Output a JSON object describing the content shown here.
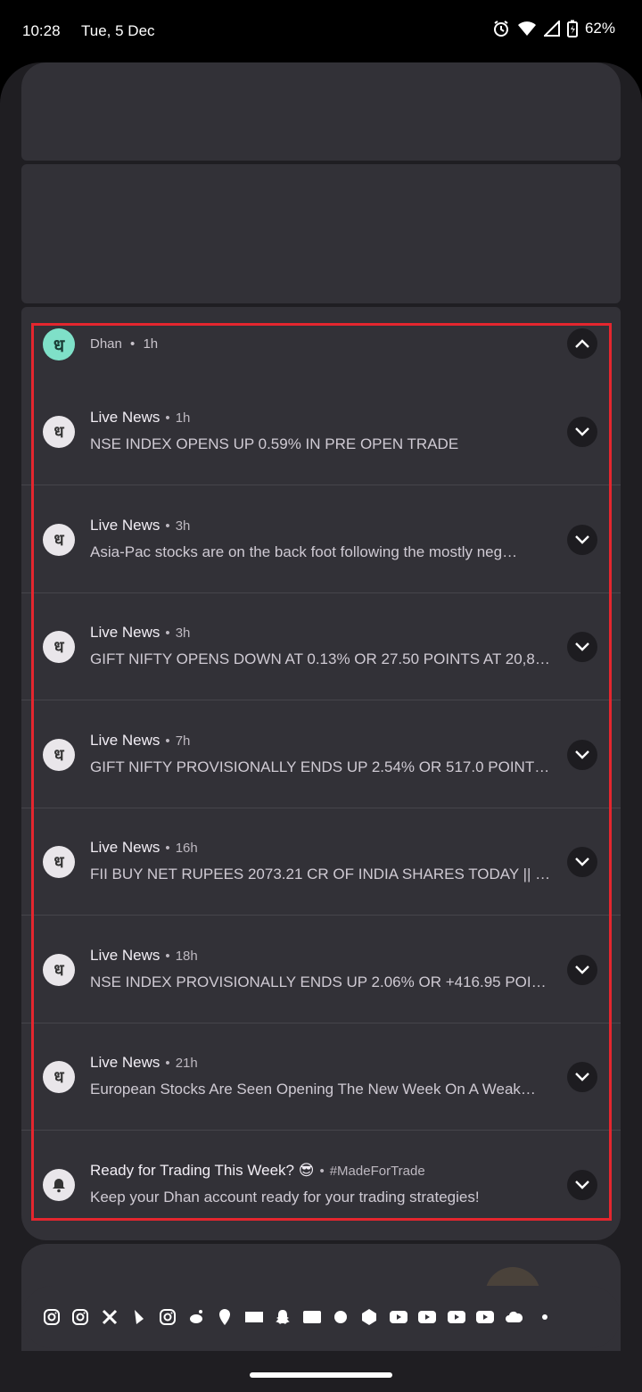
{
  "status_bar": {
    "time": "10:28",
    "date": "Tue, 5 Dec",
    "battery_percent": "62%",
    "icons": [
      "alarm-icon",
      "wifi-icon",
      "signal-icon",
      "battery-charging-icon"
    ]
  },
  "group": {
    "app_name": "Dhan",
    "time": "1h",
    "icon_glyph": "ध"
  },
  "notifications": [
    {
      "title": "Live News",
      "time": "1h",
      "body": "NSE INDEX OPENS UP 0.59% IN PRE OPEN TRADE",
      "icon": "dhan-icon"
    },
    {
      "title": "Live News",
      "time": "3h",
      "body": "Asia-Pac stocks are on the back foot following the mostly neg…",
      "icon": "dhan-icon"
    },
    {
      "title": "Live News",
      "time": "3h",
      "body": "GIFT NIFTY OPENS DOWN AT 0.13% OR 27.50 POINTS AT 20,8…",
      "icon": "dhan-icon"
    },
    {
      "title": "Live News",
      "time": "7h",
      "body": "GIFT NIFTY PROVISIONALLY ENDS UP 2.54% OR 517.0 POINTS …",
      "icon": "dhan-icon"
    },
    {
      "title": "Live News",
      "time": "16h",
      "body": "FII BUY NET RUPEES 2073.21 CR OF INDIA SHARES TODAY || DI…",
      "icon": "dhan-icon"
    },
    {
      "title": "Live News",
      "time": "18h",
      "body": "NSE INDEX PROVISIONALLY ENDS UP 2.06% OR +416.95 POIN…",
      "icon": "dhan-icon"
    },
    {
      "title": "Live News",
      "time": "21h",
      "body": "European Stocks Are Seen Opening The New Week On A Weak…",
      "icon": "dhan-icon"
    },
    {
      "title": "Ready for Trading This Week? 😎",
      "time": "#MadeForTrade",
      "body": "Keep your Dhan account ready for your trading strategies!",
      "icon": "bell-icon"
    }
  ],
  "icon_glyph": "ध",
  "partial_card": {
    "text": ""
  },
  "app_icons": [
    "instagram-icon",
    "instagram-icon",
    "x-icon",
    "rapido-icon",
    "instagram-icon",
    "reddit-icon",
    "swiggy-icon",
    "zomato-icon",
    "snapchat-icon",
    "paytm-icon",
    "settings-app-icon",
    "swiggy-instamart-icon",
    "youtube-icon",
    "youtube-icon",
    "youtube-icon",
    "youtube-icon",
    "cloud-icon"
  ],
  "colors": {
    "highlight": "#e4262e",
    "card": "#323137",
    "accent": "#7fe0c8"
  }
}
